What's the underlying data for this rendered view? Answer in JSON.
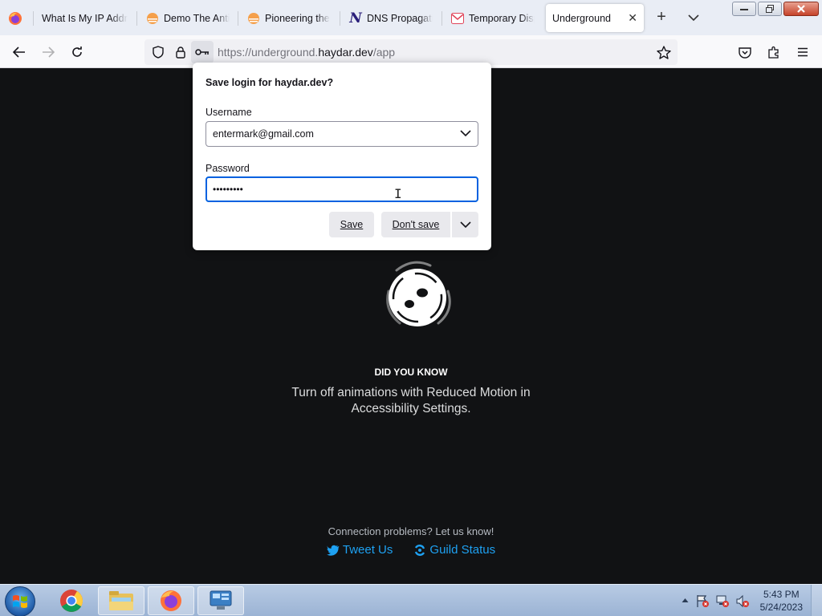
{
  "tabs": [
    {
      "title": "What Is My IP Addr",
      "icon": "globe-icon"
    },
    {
      "title": "Demo The Anti",
      "icon": "orange-sun-icon"
    },
    {
      "title": "Pioneering the",
      "icon": "orange-sun-icon"
    },
    {
      "title": "DNS Propagatio",
      "icon": "n-logo-icon"
    },
    {
      "title": "Temporary Disp",
      "icon": "mail-icon"
    },
    {
      "title": "Underground",
      "icon": "none",
      "active": true
    }
  ],
  "address": {
    "prefix": "https://underground.",
    "host": "haydar.dev",
    "path": "/app"
  },
  "popup": {
    "title": "Save login for haydar.dev?",
    "username_label": "Username",
    "username_value": "entermark@gmail.com",
    "password_label": "Password",
    "password_value": "•••••••••",
    "save_label": "Save",
    "dont_save_label": "Don't save"
  },
  "page": {
    "did_you_know": "DID YOU KNOW",
    "tip": "Turn off animations with Reduced Motion in Accessibility Settings.",
    "connection": "Connection problems? Let us know!",
    "tweet_us": "Tweet Us",
    "guild_status": "Guild Status"
  },
  "taskbar": {
    "time": "5:43 PM",
    "date": "5/24/2023"
  },
  "colors": {
    "page_bg": "#111214",
    "link": "#1ea1f2",
    "focus": "#0061e0"
  }
}
